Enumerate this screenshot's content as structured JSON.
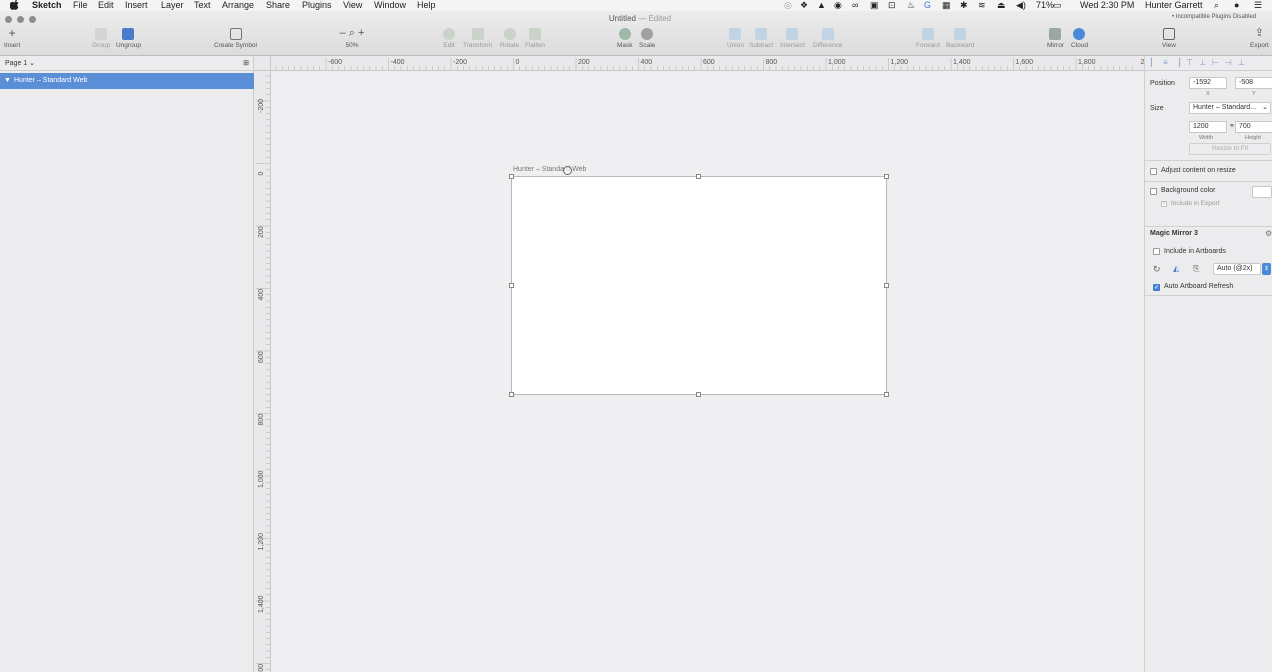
{
  "menubar": {
    "apple": "",
    "app_name": "Sketch",
    "menus": [
      "File",
      "Edit",
      "Insert",
      "Layer",
      "Text",
      "Arrange",
      "Share",
      "Plugins",
      "View",
      "Window",
      "Help"
    ],
    "battery": "71%",
    "clock": "Wed 2:30 PM",
    "user": "Hunter Garrett"
  },
  "window": {
    "title": "Untitled",
    "edited": "— Edited",
    "plugins_notice": "Incompatible Plugins Disabled"
  },
  "toolbar": {
    "insert": "Insert",
    "group": "Group",
    "ungroup": "Ungroup",
    "create_symbol": "Create Symbol",
    "zoom_level": "50%",
    "zoom_minus": "–",
    "zoom_plus": "+",
    "edit": "Edit",
    "transform": "Transform",
    "rotate": "Rotate",
    "flatten": "Flatten",
    "mask": "Mask",
    "scale": "Scale",
    "union": "Union",
    "subtract": "Subtract",
    "intersect": "Intersect",
    "difference": "Difference",
    "forward": "Forward",
    "backward": "Backward",
    "mirror": "Mirror",
    "cloud": "Cloud",
    "view": "View",
    "export": "Export"
  },
  "layers": {
    "page": "Page 1",
    "items": [
      {
        "label": "Hunter – Standard Web"
      }
    ]
  },
  "rulers": {
    "horizontal": [
      "-600",
      "-400",
      "-200",
      "0",
      "200",
      "400",
      "600",
      "800",
      "1,000",
      "1,200",
      "1,400",
      "1,600",
      "1,800",
      "2,"
    ],
    "vertical": [
      "-200",
      "0",
      "200",
      "400",
      "600",
      "800",
      "1,000",
      "1,200",
      "1,400",
      "600"
    ]
  },
  "canvas": {
    "artboard_title": "Hunter – Standard Web"
  },
  "inspector": {
    "position_label": "Position",
    "x_value": "-1592",
    "y_value": "-508",
    "x_label": "X",
    "y_label": "Y",
    "size_label": "Size",
    "size_preset": "Hunter – Standard...",
    "width_value": "1200",
    "height_value": "700",
    "width_label": "Width",
    "height_label": "Height",
    "resize_to_fit": "Resize to Fit",
    "adjust_content": "Adjust content on resize",
    "background_color": "Background color",
    "include_in_export": "Include in Export",
    "plugin_title": "Magic Mirror 3",
    "include_in_artboards": "Include in Artboards",
    "auto_scale": "Auto (@2x)",
    "auto_artboard_refresh": "Auto Artboard Refresh"
  },
  "colors": {
    "selection": "#5a8fd8",
    "accent": "#4a8ad8"
  }
}
